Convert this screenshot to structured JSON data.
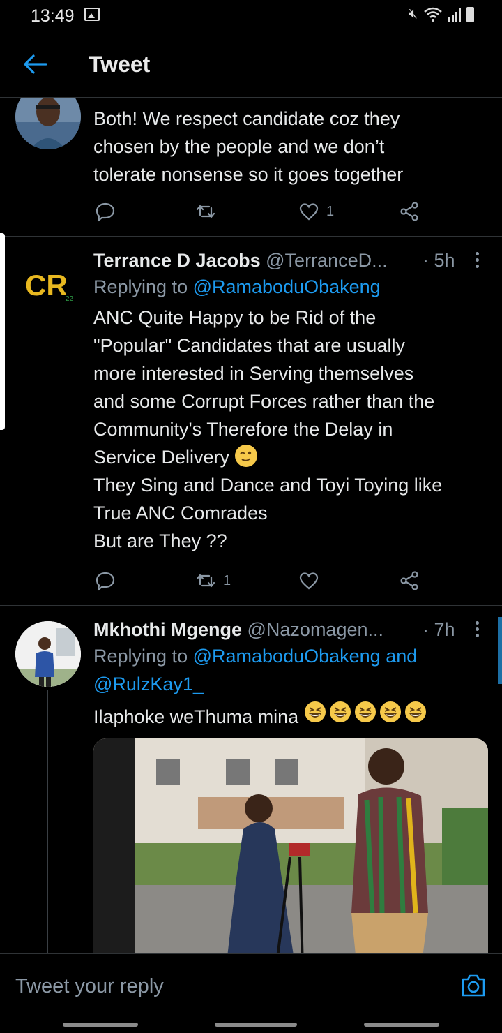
{
  "status_bar": {
    "time": "13:49"
  },
  "header": {
    "title": "Tweet"
  },
  "tweets": [
    {
      "text": "Both! We respect candidate coz they\nchosen by the people and we don’t\ntolerate nonsense so it goes together",
      "actions": {
        "retweets": "",
        "likes": "1"
      }
    },
    {
      "name": "Terrance D Jacobs",
      "handle": "@TerranceD...",
      "age": "· 5h",
      "replying_label": "Replying to",
      "replying_to": "@RamaboduObakeng",
      "text_1": "ANC Quite Happy to be Rid of the\n\"Popular\" Candidates that are usually\nmore interested in Serving themselves\nand some Corrupt Forces rather than the\nCommunity's Therefore the Delay in\nService Delivery",
      "text_2": "They Sing and Dance and Toyi Toying like\nTrue ANC Comrades\nBut are They  ??",
      "avatar_text": "CR",
      "avatar_sub": "22",
      "actions": {
        "retweets": "1",
        "likes": ""
      }
    },
    {
      "name": "Mkhothi Mgenge",
      "handle": "@Nazomagen...",
      "age": "· 7h",
      "replying_label": "Replying to",
      "replying_to": "@RamaboduObakeng and",
      "replying_to_2": "@RulzKay1_",
      "text": "Ilaphoke weThuma mina"
    }
  ],
  "reply_bar": {
    "placeholder": "Tweet your reply"
  },
  "icons": [
    "back-arrow-icon",
    "more-icon",
    "reply-icon",
    "retweet-icon",
    "like-icon",
    "share-icon",
    "camera-icon",
    "wink-emoji",
    "grinning-squinting-emoji"
  ],
  "colors": {
    "accent": "#1d9bf0",
    "background": "#000000",
    "muted": "#8b98a5"
  }
}
